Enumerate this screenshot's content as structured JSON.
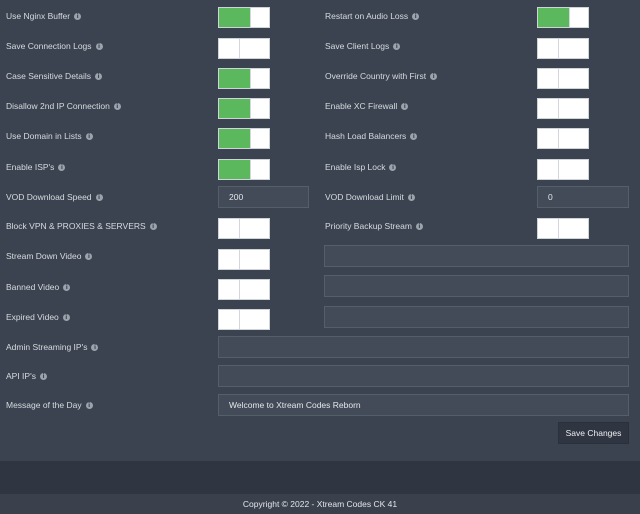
{
  "left_rows": [
    {
      "label": "Use Nginx Buffer",
      "state": "on"
    },
    {
      "label": "Save Connection Logs",
      "state": "off"
    },
    {
      "label": "Case Sensitive Details",
      "state": "on"
    },
    {
      "label": "Disallow 2nd IP Connection",
      "state": "on"
    },
    {
      "label": "Use Domain in Lists",
      "state": "on"
    },
    {
      "label": "Enable ISP's",
      "state": "on"
    },
    {
      "label": "VOD Download Speed",
      "value": "200"
    },
    {
      "label": "Block VPN & PROXIES & SERVERS",
      "state": "off"
    },
    {
      "label": "Stream Down Video",
      "state": "off"
    },
    {
      "label": "Banned Video",
      "state": "off"
    },
    {
      "label": "Expired Video",
      "state": "off"
    }
  ],
  "right_rows": [
    {
      "label": "Restart on Audio Loss",
      "state": "on"
    },
    {
      "label": "Save Client Logs",
      "state": "off"
    },
    {
      "label": "Override Country with First",
      "state": "off"
    },
    {
      "label": "Enable XC Firewall",
      "state": "off"
    },
    {
      "label": "Hash Load Balancers",
      "state": "off"
    },
    {
      "label": "Enable Isp Lock",
      "state": "off"
    },
    {
      "label": "VOD Download Limit",
      "value": "0"
    },
    {
      "label": "Priority Backup Stream",
      "state": "off"
    }
  ],
  "video_url_fields": {
    "stream_down": "",
    "banned": "",
    "expired": ""
  },
  "wide_rows": [
    {
      "label": "Admin Streaming IP's",
      "value": ""
    },
    {
      "label": "API IP's",
      "value": ""
    },
    {
      "label": "Message of the Day",
      "value": "Welcome to Xtream Codes Reborn"
    }
  ],
  "save_button": "Save Changes",
  "footer": "Copyright © 2022 - Xtream Codes CK 41",
  "colors": {
    "toggle_on": "#5cb85c",
    "background": "#3b4350",
    "button": "#2f3541"
  },
  "icons": {
    "info": "info-icon"
  }
}
